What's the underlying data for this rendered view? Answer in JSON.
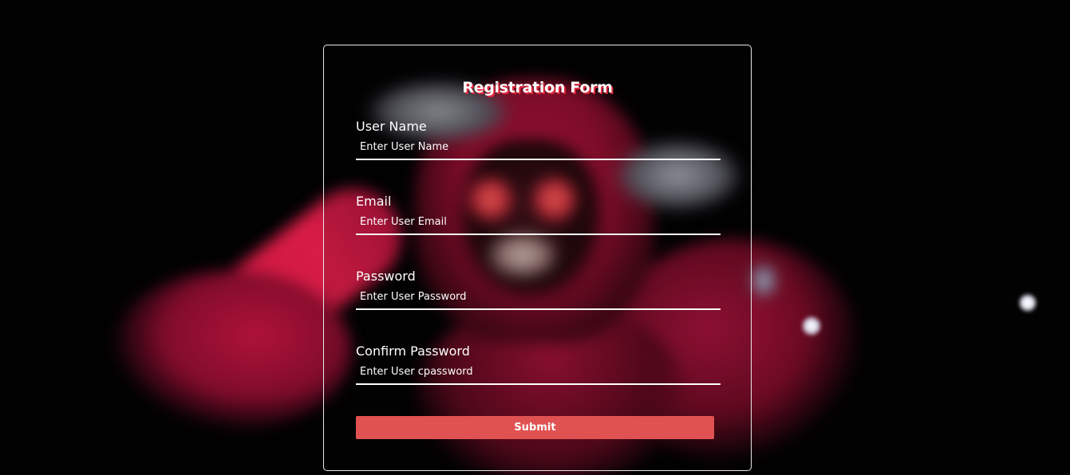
{
  "form": {
    "title": "Registration Form",
    "fields": [
      {
        "label": "User Name",
        "placeholder": "Enter User Name",
        "value": ""
      },
      {
        "label": "Email",
        "placeholder": "Enter User Email",
        "value": ""
      },
      {
        "label": "Password",
        "placeholder": "Enter User Password",
        "value": ""
      },
      {
        "label": "Confirm Password",
        "placeholder": "Enter User cpassword",
        "value": ""
      }
    ],
    "submit_label": "Submit"
  },
  "colors": {
    "background": "#020203",
    "accent": "#e05252",
    "title_shadow": "#e0283c",
    "text": "#ffffff"
  },
  "background_image": {
    "description_icon": "hooded-figure-background"
  }
}
